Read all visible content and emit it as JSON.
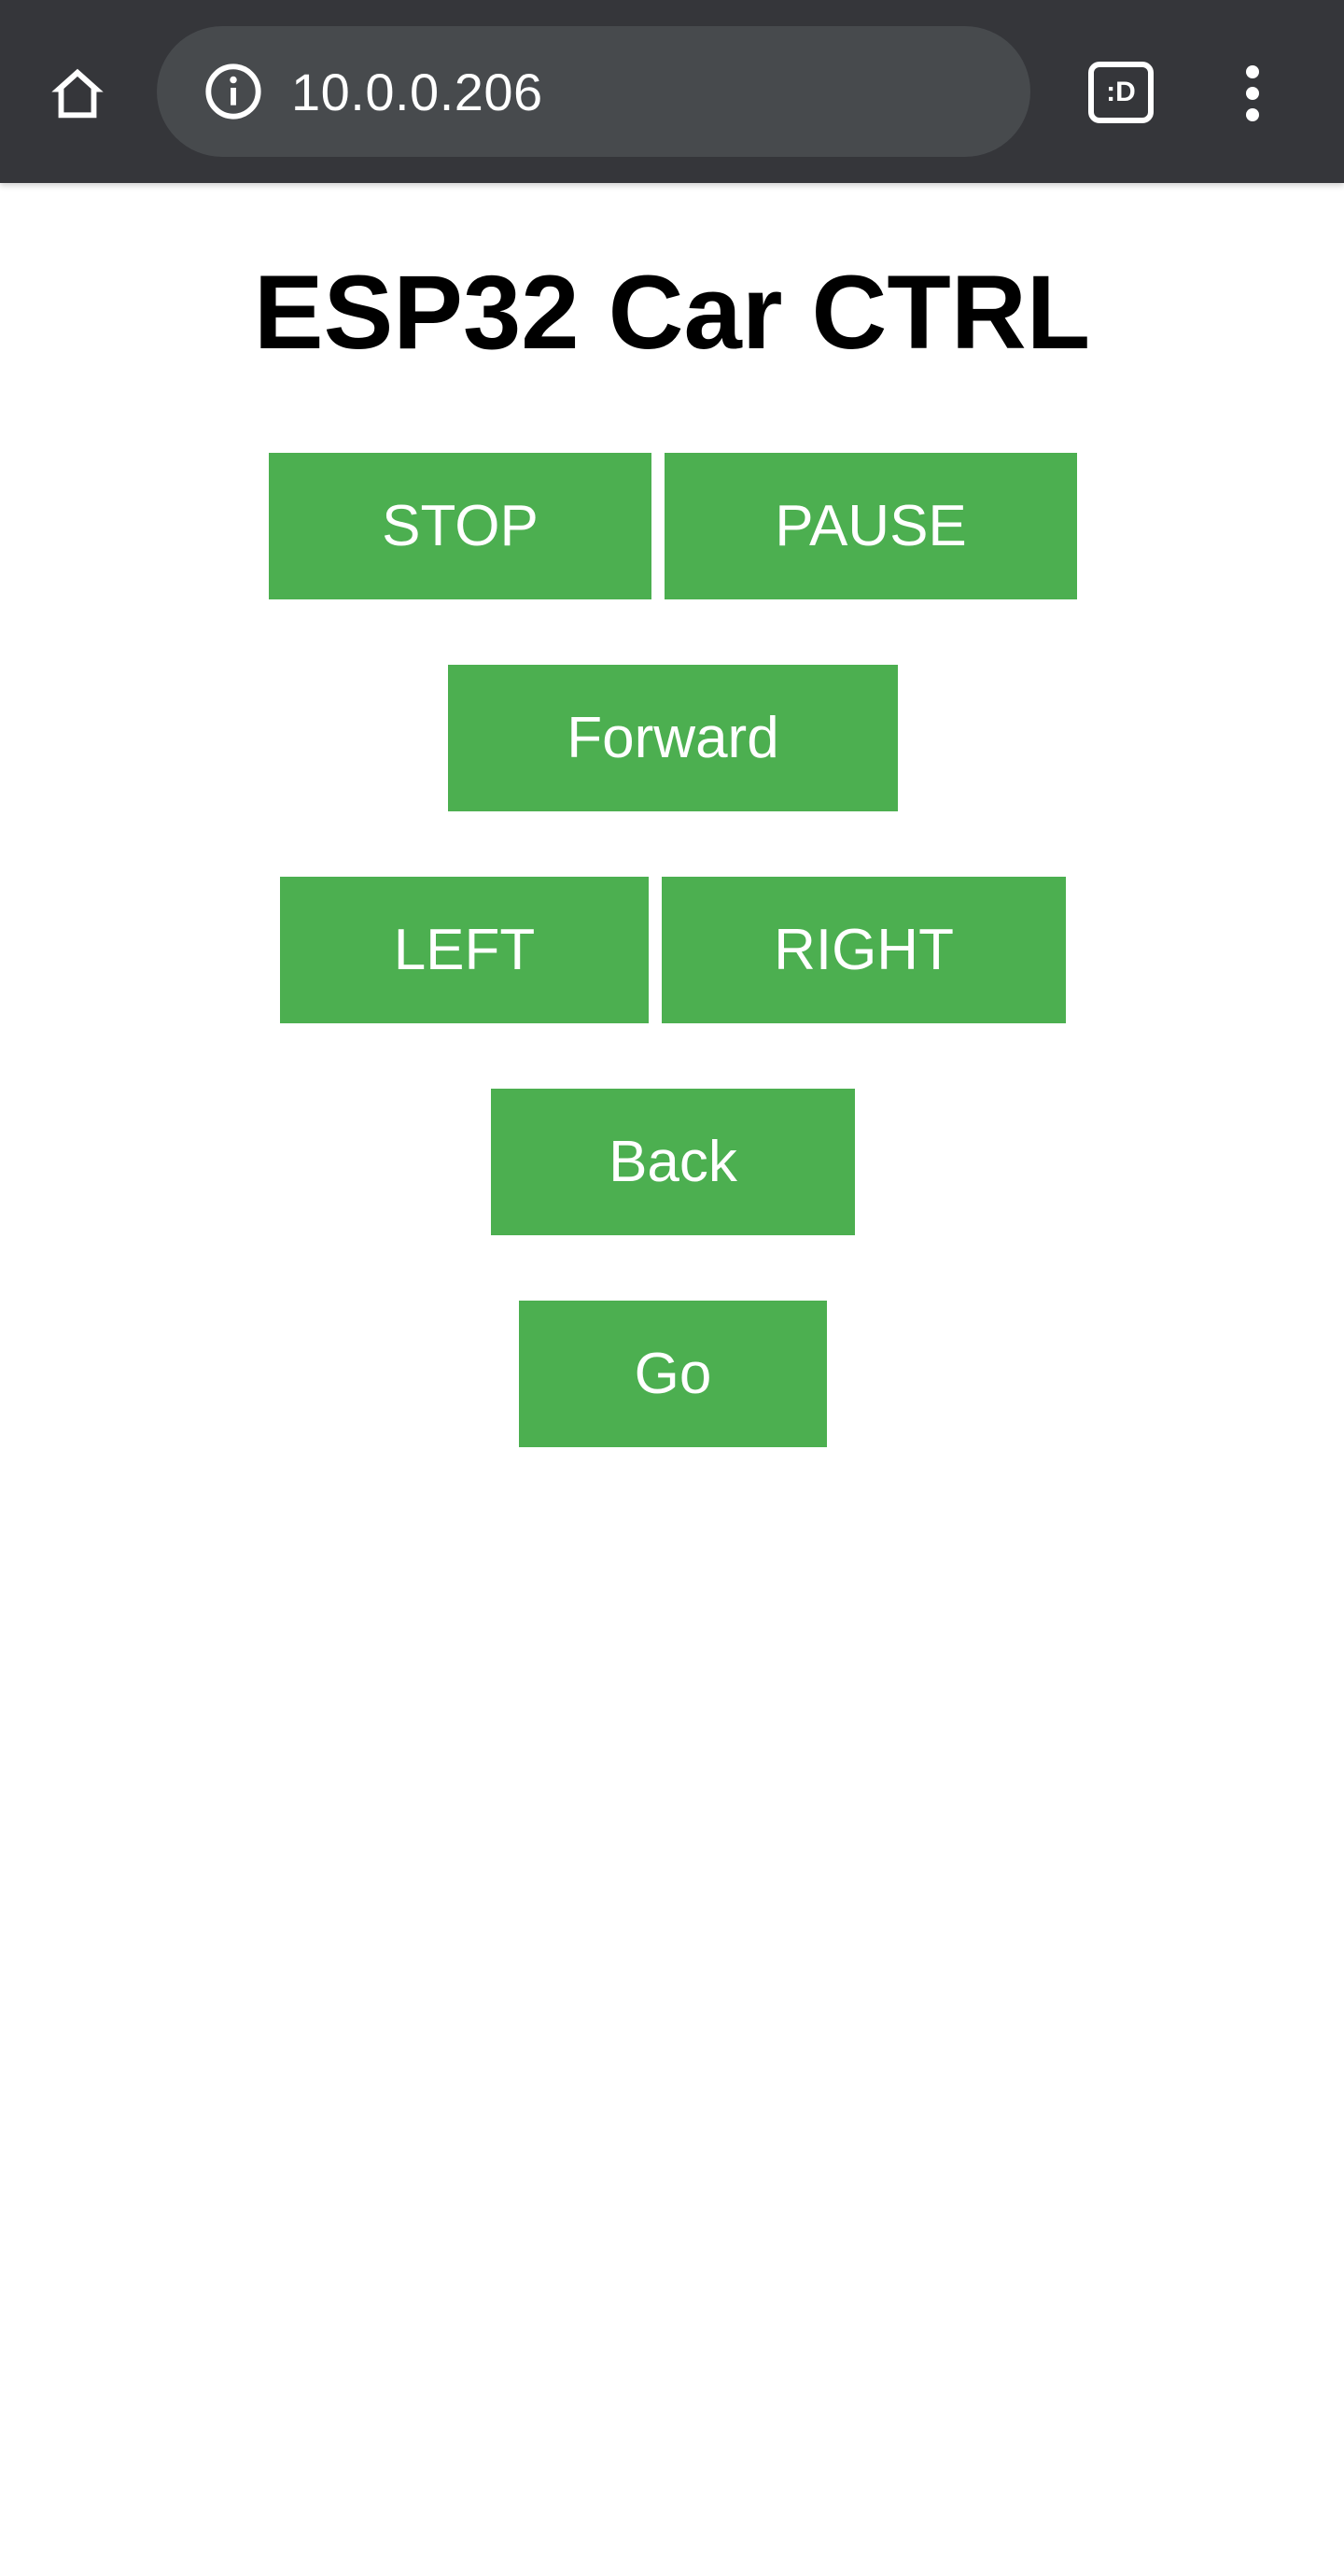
{
  "browser": {
    "url": "10.0.0.206",
    "tab_switcher_label": ":D",
    "icons": {
      "home": "home-icon",
      "info": "info-icon",
      "tabs": "tab-switcher-icon",
      "menu": "more-vert-icon"
    },
    "toolbar_color": "#35363a"
  },
  "page": {
    "title": "ESP32 Car CTRL",
    "button_color": "#4caf50",
    "buttons": {
      "stop": "STOP",
      "pause": "PAUSE",
      "forward": "Forward",
      "left": "LEFT",
      "right": "RIGHT",
      "back": "Back",
      "go": "Go"
    }
  }
}
